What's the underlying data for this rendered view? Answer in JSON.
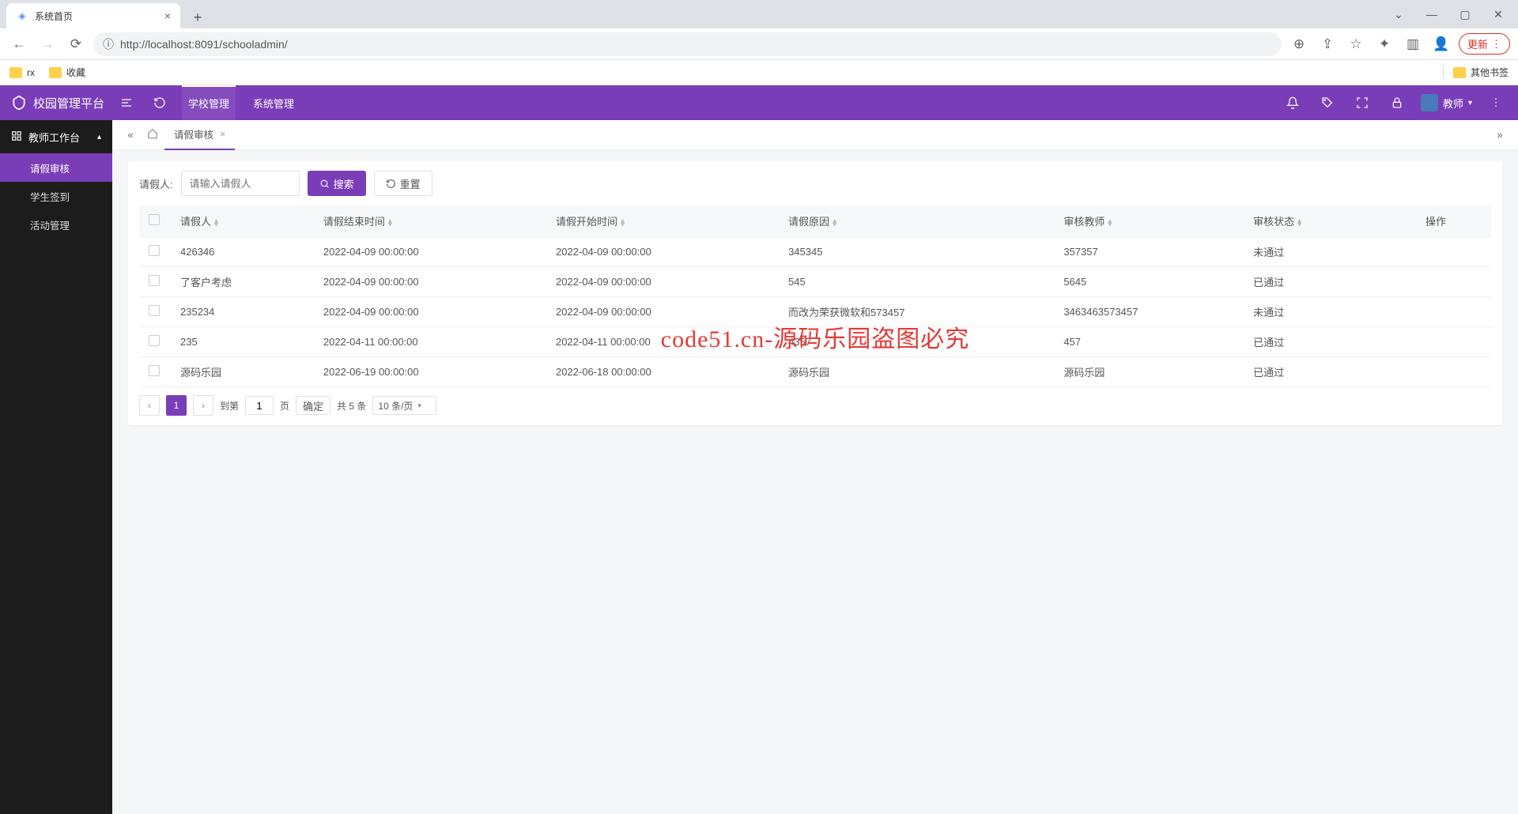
{
  "browser": {
    "tab_title": "系统首页",
    "url_display": "http://localhost:8091/schooladmin/",
    "url_host_part": "localhost",
    "bookmarks": [
      "rx",
      "收藏"
    ],
    "other_bookmarks": "其他书签",
    "update_label": "更新"
  },
  "header": {
    "app_name": "校园管理平台",
    "nav": [
      "学校管理",
      "系统管理"
    ],
    "user_role": "教师"
  },
  "sidebar": {
    "section": "教师工作台",
    "items": [
      {
        "label": "请假审核",
        "active": true
      },
      {
        "label": "学生签到",
        "active": false
      },
      {
        "label": "活动管理",
        "active": false
      }
    ]
  },
  "page_tab": "请假审核",
  "filter": {
    "label": "请假人:",
    "placeholder": "请输入请假人",
    "search_btn": "搜索",
    "reset_btn": "重置"
  },
  "table": {
    "columns": [
      "",
      "请假人",
      "请假结束时间",
      "请假开始时间",
      "请假原因",
      "审核教师",
      "审核状态",
      "操作"
    ],
    "rows": [
      {
        "person": "426346",
        "end": "2022-04-09 00:00:00",
        "start": "2022-04-09 00:00:00",
        "reason": "345345",
        "teacher": "357357",
        "status": "未通过"
      },
      {
        "person": "了客户考虑",
        "end": "2022-04-09 00:00:00",
        "start": "2022-04-09 00:00:00",
        "reason": "545",
        "teacher": "5645",
        "status": "已通过"
      },
      {
        "person": "235234",
        "end": "2022-04-09 00:00:00",
        "start": "2022-04-09 00:00:00",
        "reason": "而改为荣获微软和573457",
        "teacher": "3463463573457",
        "status": "未通过"
      },
      {
        "person": "235",
        "end": "2022-04-11 00:00:00",
        "start": "2022-04-11 00:00:00",
        "reason": "4357",
        "teacher": "457",
        "status": "已通过"
      },
      {
        "person": "源码乐园",
        "end": "2022-06-19 00:00:00",
        "start": "2022-06-18 00:00:00",
        "reason": "源码乐园",
        "teacher": "源码乐园",
        "status": "已通过"
      }
    ]
  },
  "pager": {
    "current": "1",
    "goto_label": "到第",
    "page_suffix": "页",
    "goto_value": "1",
    "confirm": "确定",
    "total": "共 5 条",
    "size": "10 条/页"
  },
  "watermark": "code51.cn-源码乐园盗图必究"
}
